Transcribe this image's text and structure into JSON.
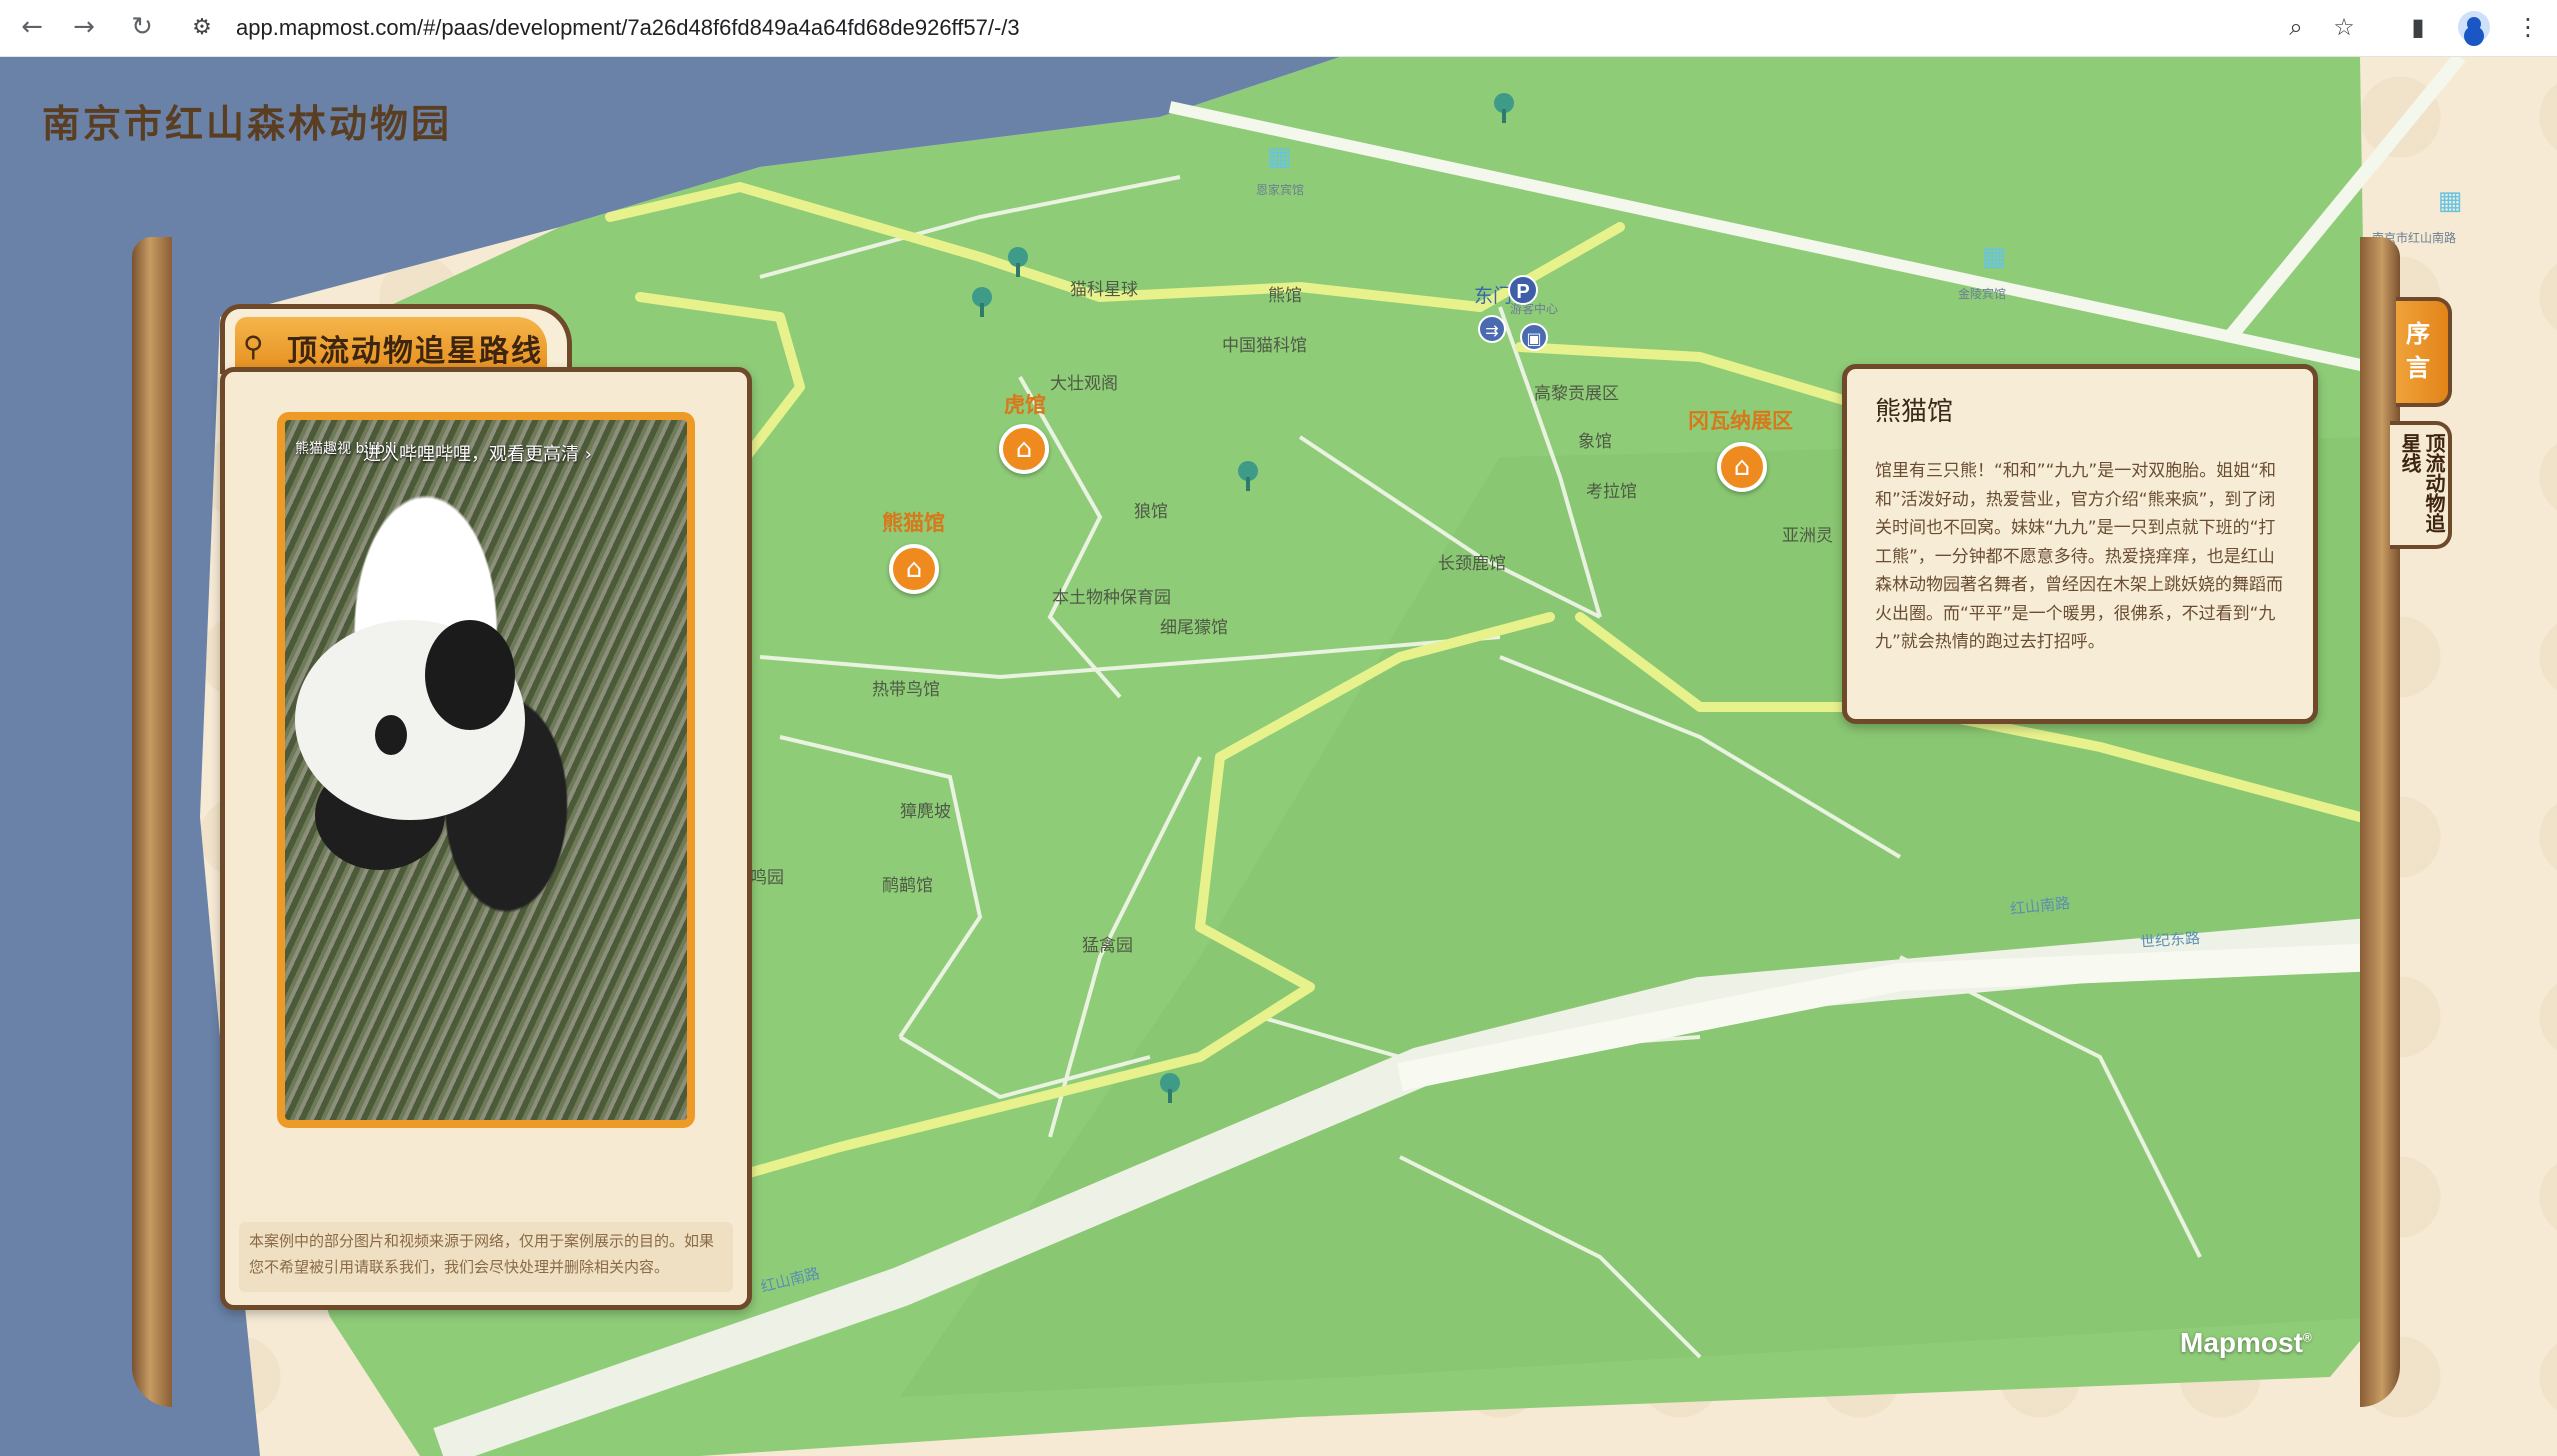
{
  "browser": {
    "url": "app.mapmost.com/#/paas/development/7a26d48f6fd849a4a64fd68de926ff57/-/3",
    "back_icon": "arrow-left-icon",
    "forward_icon": "arrow-right-icon",
    "reload_icon": "reload-icon"
  },
  "page": {
    "title": "南京市红山森林动物园"
  },
  "left_panel": {
    "tab_title": "顶流动物追星路线",
    "video_logo": "熊猫趣视 bilibili",
    "video_caption": "进入哔哩哔哩，观看更高清 ›",
    "note": "本案例中的部分图片和视频来源于网络，仅用于案例展示的目的。如果您不希望被引用请联系我们，我们会尽快处理并删除相关内容。"
  },
  "info_box": {
    "title": "熊猫馆",
    "body": "馆里有三只熊！“和和”“九九”是一对双胞胎。姐姐“和和”活泼好动，热爱营业，官方介绍“熊来疯”，到了闭关时间也不回窝。妹妹“九九”是一只到点就下班的“打工熊”，一分钟都不愿意多待。热爱挠痒痒，也是红山森林动物园著名舞者，曾经因在木架上跳妖娆的舞蹈而火出圈。而“平平”是一个暖男，很佛系，不过看到“九九”就会热情的跑过去打招呼。"
  },
  "side_tabs": {
    "preface": "序言",
    "route": "顶流动物追星线"
  },
  "map": {
    "brand": "Mapmost",
    "brand_mark": "®",
    "poi": {
      "tiger": "虎馆",
      "panda": "熊猫馆",
      "gawana": "冈瓦纳展区"
    },
    "labels": {
      "cat_planet": "猫科星球",
      "bear": "熊馆",
      "cat_museum": "中国猫科馆",
      "east_gate": "东门",
      "visitor_center": "游客中心",
      "highland": "高黎贡展区",
      "elephant": "象馆",
      "koala": "考拉馆",
      "asia": "亚洲灵",
      "big_view": "大壮观阁",
      "wolf": "狼馆",
      "native": "本土物种保育园",
      "meerkat": "细尾獴馆",
      "giraffe": "长颈鹿馆",
      "tropical": "热带鸟馆",
      "muntjac": "獐麂坡",
      "bird_garden": "鸣园",
      "ostrich": "鸸鹋馆",
      "raptor": "猛禽园",
      "road1": "红山南路",
      "road2": "红山南路",
      "road3": "世纪东路",
      "bldg1": "恩家宾馆",
      "bldg2": "金陵宾馆",
      "bldg3": "南京市红山南路"
    }
  },
  "colors": {
    "map_green": "#8fcc78",
    "route_yellow": "#e8f28c",
    "water_blue": "#6a82a8",
    "accent_orange": "#ef8a1e",
    "frame_brown": "#6e4a2a"
  }
}
